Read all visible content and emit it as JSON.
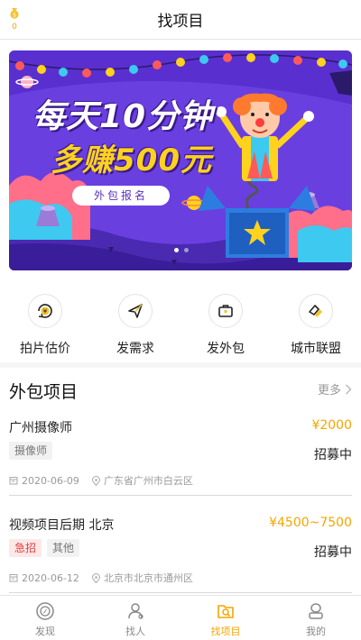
{
  "header": {
    "title": "找项目",
    "coin_count": "0"
  },
  "banner": {
    "line1": "每天10分钟",
    "line2": "多赚500元",
    "button": "外包报名",
    "slides": 2,
    "active_slide": 1
  },
  "actions": [
    {
      "label": "拍片估价",
      "icon": "camera-estimate-icon"
    },
    {
      "label": "发需求",
      "icon": "paper-plane-icon"
    },
    {
      "label": "发外包",
      "icon": "briefcase-icon"
    },
    {
      "label": "城市联盟",
      "icon": "handshake-icon"
    }
  ],
  "section": {
    "title": "外包项目",
    "more": "更多"
  },
  "projects": [
    {
      "name": "广州摄像师",
      "price": "¥2000",
      "tags": [
        "摄像师"
      ],
      "status": "招募中",
      "date": "2020-06-09",
      "location": "广东省广州市白云区"
    },
    {
      "name": "视频项目后期 北京",
      "price": "¥4500~7500",
      "tags": [
        "急招",
        "其他"
      ],
      "status": "招募中",
      "date": "2020-06-12",
      "location": "北京市北京市通州区"
    }
  ],
  "tabs": [
    {
      "label": "发现",
      "active": false
    },
    {
      "label": "找人",
      "active": false
    },
    {
      "label": "找项目",
      "active": true
    },
    {
      "label": "我的",
      "active": false
    }
  ],
  "colors": {
    "accent": "#f5a500",
    "urgent": "#e04040",
    "banner_bg": "#6a3fe0"
  }
}
